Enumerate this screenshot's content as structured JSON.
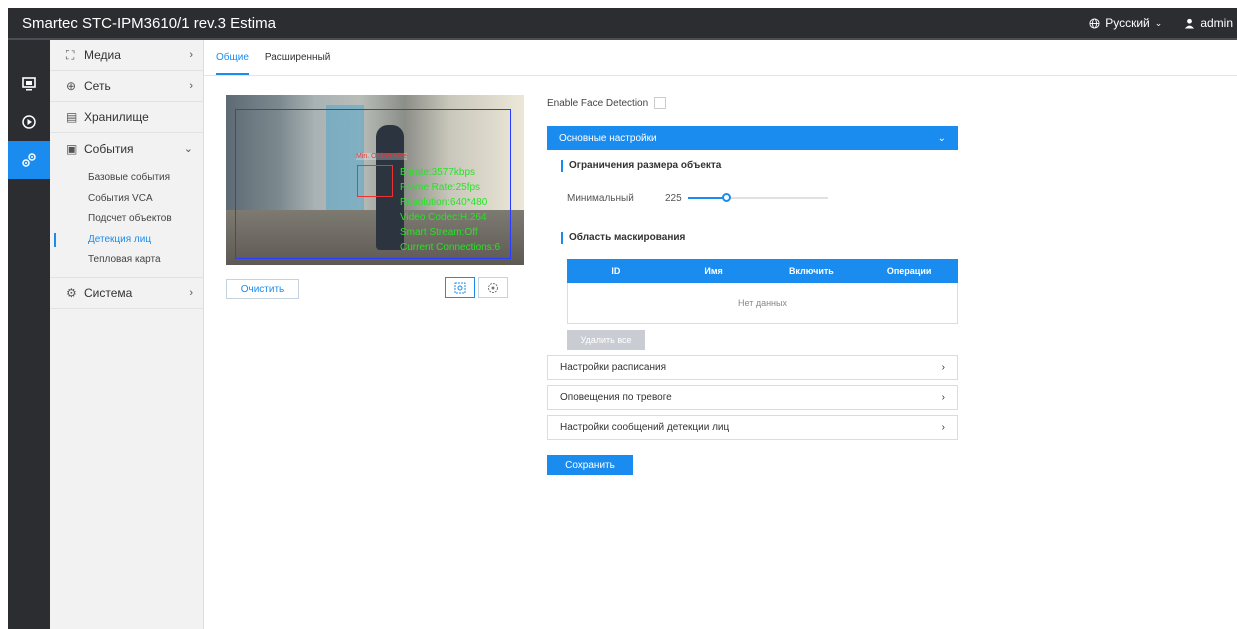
{
  "header": {
    "title": "Smartec STC-IPM3610/1 rev.3 Estima",
    "language": "Русский",
    "user": "admin"
  },
  "iconbar": {
    "items": [
      {
        "icon": "monitor-icon"
      },
      {
        "icon": "playback-icon"
      },
      {
        "icon": "settings-gears-icon",
        "active": true
      }
    ]
  },
  "sidebar": {
    "items": [
      {
        "label": "Медиа",
        "icon": "media-icon"
      },
      {
        "label": "Сеть",
        "icon": "globe-icon"
      },
      {
        "label": "Хранилище",
        "icon": "storage-icon"
      },
      {
        "label": "События",
        "icon": "events-icon"
      },
      {
        "label": "Система",
        "icon": "system-icon"
      }
    ],
    "events_sub": [
      "Базовые события",
      "События VCA",
      "Подсчет объектов",
      "Детекция лиц",
      "Тепловая карта"
    ],
    "active_sub": "Детекция лиц"
  },
  "tabs": [
    "Общие",
    "Расширенный"
  ],
  "video": {
    "min_object_label": "Min. Object Size",
    "osd": [
      "Bitrate:3577kbps",
      "Frame Rate:25fps",
      "Resolution:640*480",
      "Video Codec:H.264",
      "Smart Stream:Off",
      "Current Connections:6"
    ],
    "clear_label": "Очистить"
  },
  "form": {
    "face_detection_label": "Enable Face Detection",
    "face_detection_checked": false,
    "basic_settings_label": "Основные настройки",
    "size_limit_title": "Ограничения размера объекта",
    "minimum_label": "Минимальный",
    "minimum_value": "225",
    "minimum_fraction": 0.28,
    "mask_area_title": "Область маскирования",
    "table_headers": [
      "ID",
      "Имя",
      "Включить",
      "Операции"
    ],
    "table_empty": "Нет данных",
    "delete_all_label": "Удалить все",
    "schedule_label": "Настройки расписания",
    "alarm_label": "Оповещения по тревоге",
    "face_msg_label": "Настройки сообщений детекции лиц",
    "save_label": "Сохранить"
  },
  "colors": {
    "accent": "#1a8cf0",
    "header_bg": "#2b2d31",
    "osd_text": "#25e425"
  }
}
